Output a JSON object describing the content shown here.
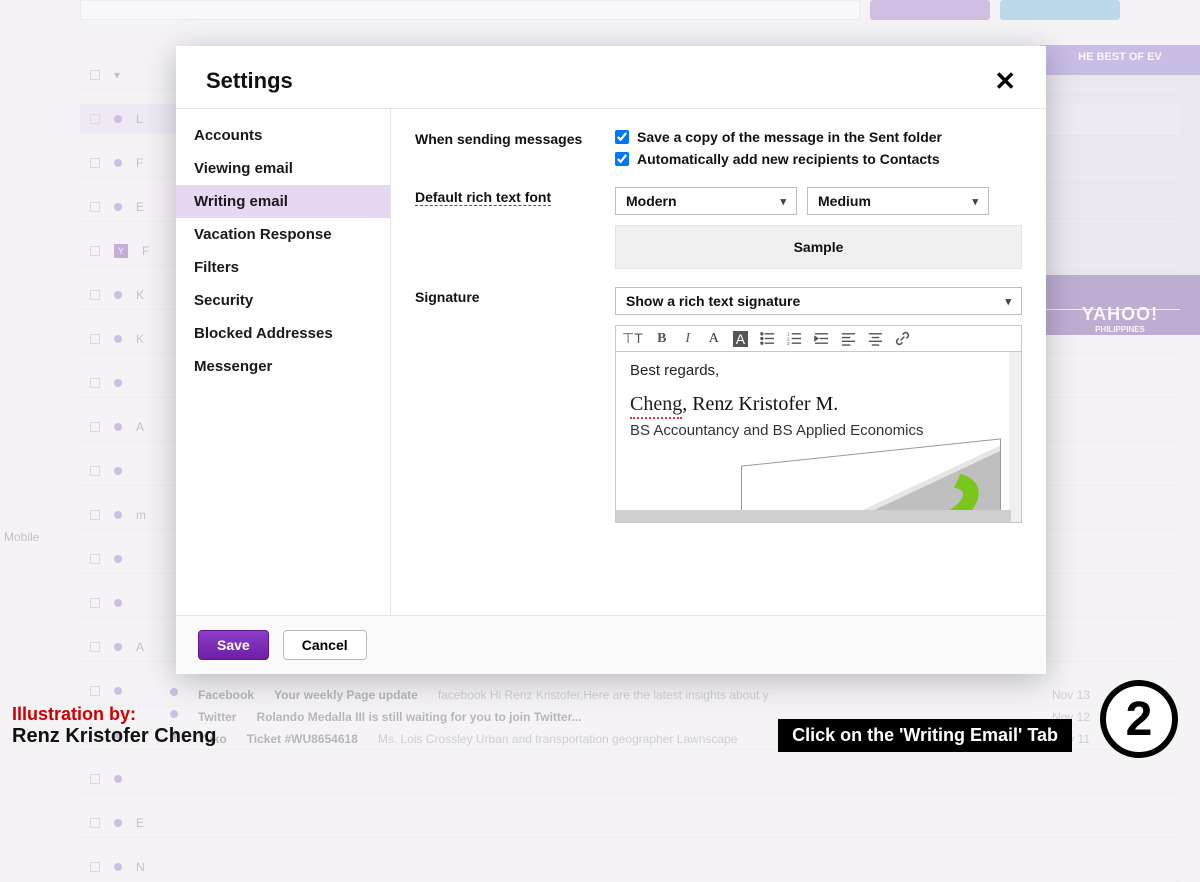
{
  "background": {
    "sidebar_label": "Mobile",
    "ad_top": "HE BEST OF EV",
    "ad_brand": "YAHOO!",
    "ad_sub": "PHILIPPINES",
    "rows": [
      {
        "sender": "Facebook",
        "subject": "Your weekly Page update",
        "preview": "facebook Hi Renz Kristofer,Here are the latest insights about y",
        "date": "Nov 13"
      },
      {
        "sender": "Twitter",
        "subject": "Rolando Medalla III is still waiting for you to join Twitter...",
        "preview": "Rolando Medalla III is still...",
        "date": "Nov 12"
      },
      {
        "sender": "Yuko",
        "subject": "Ticket #WU8654618",
        "preview": "Ms. Lois Crossley Urban and transportation geographer Lawnscape",
        "date": "Nov 11"
      }
    ]
  },
  "modal": {
    "title": "Settings",
    "nav": {
      "items": [
        "Accounts",
        "Viewing email",
        "Writing email",
        "Vacation Response",
        "Filters",
        "Security",
        "Blocked Addresses",
        "Messenger"
      ],
      "active_index": 2
    },
    "section": {
      "sending_label": "When sending messages",
      "cb_save": "Save a copy of the message in the Sent folder",
      "cb_auto": "Automatically add new recipients to Contacts",
      "font_label": "Default rich text font",
      "font_family": "Modern",
      "font_size": "Medium",
      "sample": "Sample",
      "signature_label": "Signature",
      "signature_mode": "Show a rich text signature",
      "sig": {
        "greeting": "Best regards,",
        "name_last": "Cheng",
        "name_rest": ", Renz Kristofer M.",
        "degree": "BS Accountancy and BS Applied Economics"
      }
    },
    "footer": {
      "save": "Save",
      "cancel": "Cancel"
    }
  },
  "annotation": {
    "illus_by": "Illustration by:",
    "illus_name": "Renz Kristofer Cheng",
    "caption": "Click on the 'Writing Email' Tab",
    "step": "2"
  }
}
